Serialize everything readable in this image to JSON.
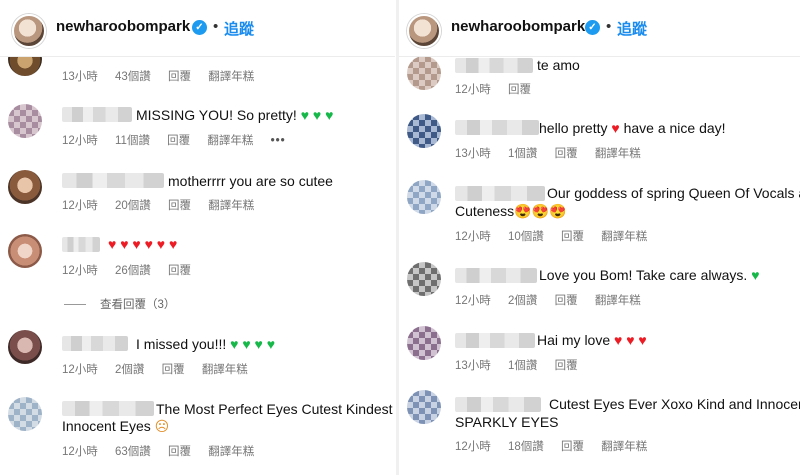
{
  "left": {
    "header": {
      "username": "newharoobompark",
      "dot": "•",
      "follow": "追蹤"
    },
    "comments": [
      {
        "text": "",
        "meta": [
          "13小時",
          "43個讚",
          "回覆",
          "翻譯年糕"
        ]
      },
      {
        "text": "MISSING YOU! So pretty! ",
        "emoji": "♥ ♥ ♥",
        "meta": [
          "12小時",
          "11個讚",
          "回覆",
          "翻譯年糕",
          "•••"
        ]
      },
      {
        "text": "motherrrr you are so cutee",
        "meta": [
          "12小時",
          "20個讚",
          "回覆",
          "翻譯年糕"
        ]
      },
      {
        "text": "",
        "emoji": "♥ ♥ ♥ ♥ ♥ ♥",
        "meta": [
          "12小時",
          "26個讚",
          "回覆"
        ]
      },
      {
        "text": "I missed you!!! ",
        "emoji": "♥ ♥ ♥ ♥",
        "meta": [
          "12小時",
          "2個讚",
          "回覆",
          "翻譯年糕"
        ]
      },
      {
        "text": "The Most Perfect Eyes Cutest Kindest Mo",
        "text2": "Innocent Eyes",
        "emoji": "☹",
        "meta": [
          "12小時",
          "63個讚",
          "回覆",
          "翻譯年糕"
        ]
      }
    ],
    "view_replies": "查看回覆（3）"
  },
  "right": {
    "header": {
      "username": "newharoobompark",
      "dot": "•",
      "follow": "追蹤"
    },
    "comments": [
      {
        "text": "te amo",
        "meta": [
          "12小時",
          "回覆"
        ]
      },
      {
        "text": "hello pretty ",
        "emoji": "♥",
        "text_after": " have a nice day!",
        "meta": [
          "13小時",
          "1個讚",
          "回覆",
          "翻譯年糕"
        ]
      },
      {
        "text": "Our goddess of spring Queen Of Vocals a",
        "text2": "Cuteness",
        "emoji": "😍😍😍",
        "meta": [
          "12小時",
          "10個讚",
          "回覆",
          "翻譯年糕"
        ]
      },
      {
        "text": "Love you Bom! Take care always. ",
        "emoji": "♥",
        "meta": [
          "12小時",
          "2個讚",
          "回覆",
          "翻譯年糕"
        ]
      },
      {
        "text": "Hai my love ",
        "emoji": "♥ ♥ ♥",
        "meta": [
          "13小時",
          "1個讚",
          "回覆"
        ]
      },
      {
        "text": "Cutest Eyes Ever Xoxo Kind and Innocent",
        "text2": "SPARKLY EYES",
        "meta": [
          "12小時",
          "18個讚",
          "回覆",
          "翻譯年糕"
        ]
      }
    ]
  },
  "colors": {
    "link": "#1a8cef",
    "verified": "#1d9bf0",
    "heart_red": "#ed1c24",
    "heart_green": "#16b84a"
  },
  "icons": {
    "verified": "verified-badge-icon",
    "heart": "heart-icon"
  }
}
